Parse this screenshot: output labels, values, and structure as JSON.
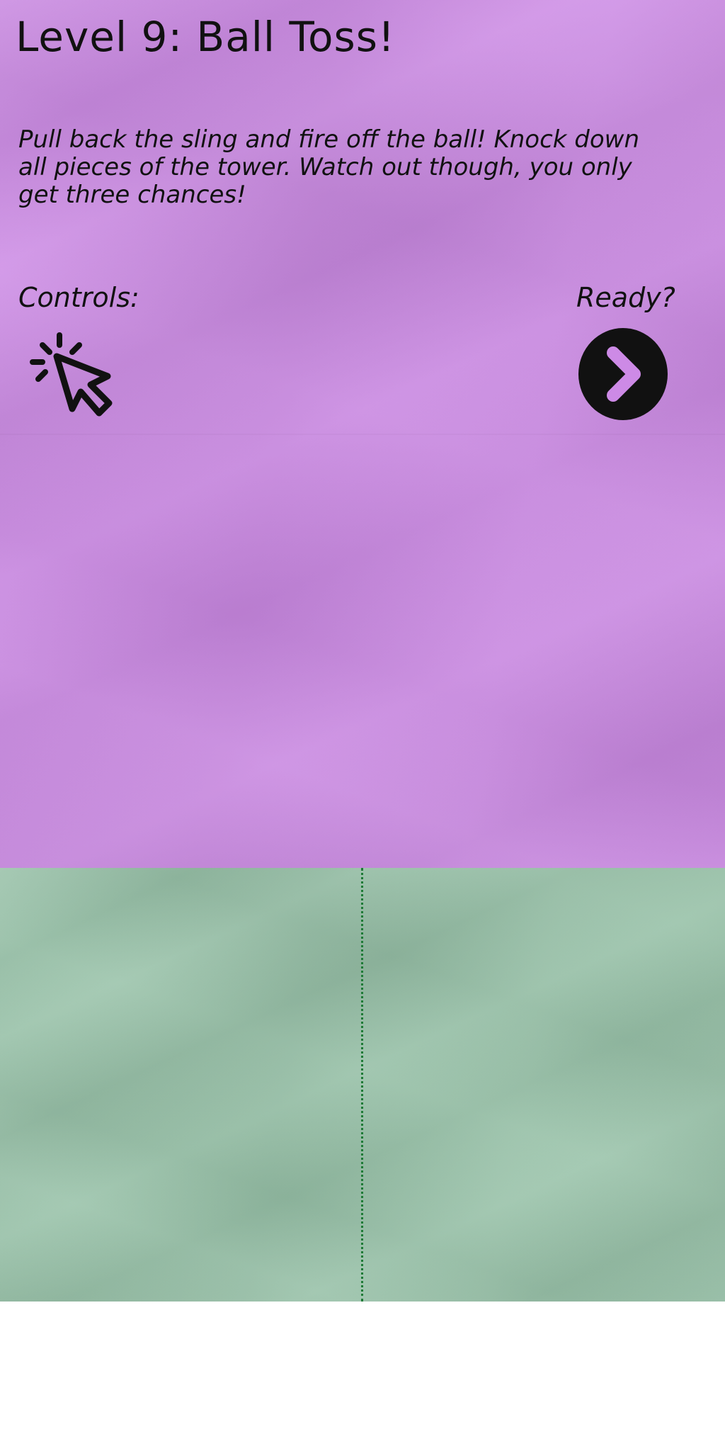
{
  "level": {
    "title": "Level 9: Ball Toss!",
    "instructions": "Pull back the sling and fire off the ball! Knock down all pieces of the tower. Watch out though, you only get three chances!",
    "controls_label": "Controls:",
    "controls_icon": "mouse-click-icon",
    "ready_label": "Ready?",
    "next_icon": "chevron-right-icon"
  },
  "colors": {
    "intro_background": "#cd8ae6",
    "play_background": "#99c4aa",
    "divider": "#1e7a36",
    "ink": "#111111",
    "footer": "#ffffff"
  }
}
